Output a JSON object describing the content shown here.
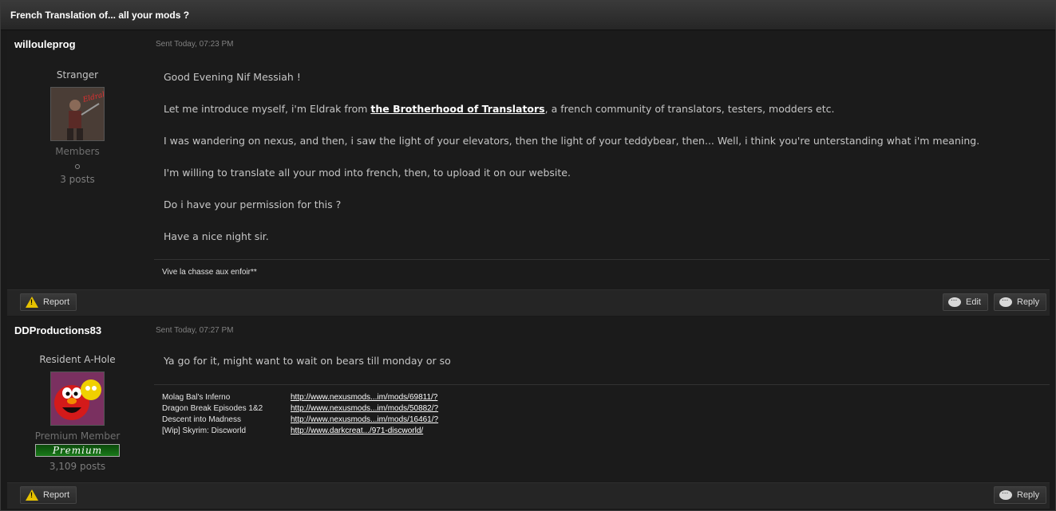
{
  "thread_title": "French Translation of... all your mods ?",
  "posts": [
    {
      "author": "willouleprog",
      "rank": "Stranger",
      "group": "Members",
      "posts": "3 posts",
      "sent": "Sent Today, 07:23 PM",
      "p1": "Good Evening Nif Messiah !",
      "p2_pre": "Let me introduce myself, i'm Eldrak from ",
      "p2_link": "the Brotherhood of Translators",
      "p2_post": ", a french community of translators, testers, modders etc.",
      "p3": "I was wandering on nexus, and then, i saw the light of your elevators, then the light of your teddybear, then... Well, i think you're unterstanding what i'm meaning.",
      "p4": "I'm willing to translate all your mod into french, then, to upload it on our website.",
      "p5": "Do i have your permission for this ?",
      "p6": "Have a nice night sir.",
      "signature": "Vive la chasse aux enfoir**",
      "avatar_text": "Eldrak"
    },
    {
      "author": "DDProductions83",
      "rank": "Resident A-Hole",
      "group": "Premium Member",
      "badge": "Premium",
      "posts": "3,109 posts",
      "sent": "Sent Today, 07:27 PM",
      "p1": "Ya go for it, might want to wait on bears till monday or so",
      "sig_rows": [
        {
          "name": "Molag Bal's Inferno",
          "link": "http://www.nexusmods...im/mods/69811/?"
        },
        {
          "name": "Dragon Break Episodes 1&2",
          "link": "http://www.nexusmods...im/mods/50882/?"
        },
        {
          "name": "Descent into Madness",
          "link": "http://www.nexusmods...im/mods/16461/?"
        },
        {
          "name": "[Wip] Skyrim: Discworld",
          "link": "http://www.darkcreat.../971-discworld/"
        }
      ]
    }
  ],
  "buttons": {
    "report": "Report",
    "edit": "Edit",
    "reply": "Reply"
  },
  "colors": {
    "warning": "#e6c200",
    "premium": "#1a7a1a"
  }
}
